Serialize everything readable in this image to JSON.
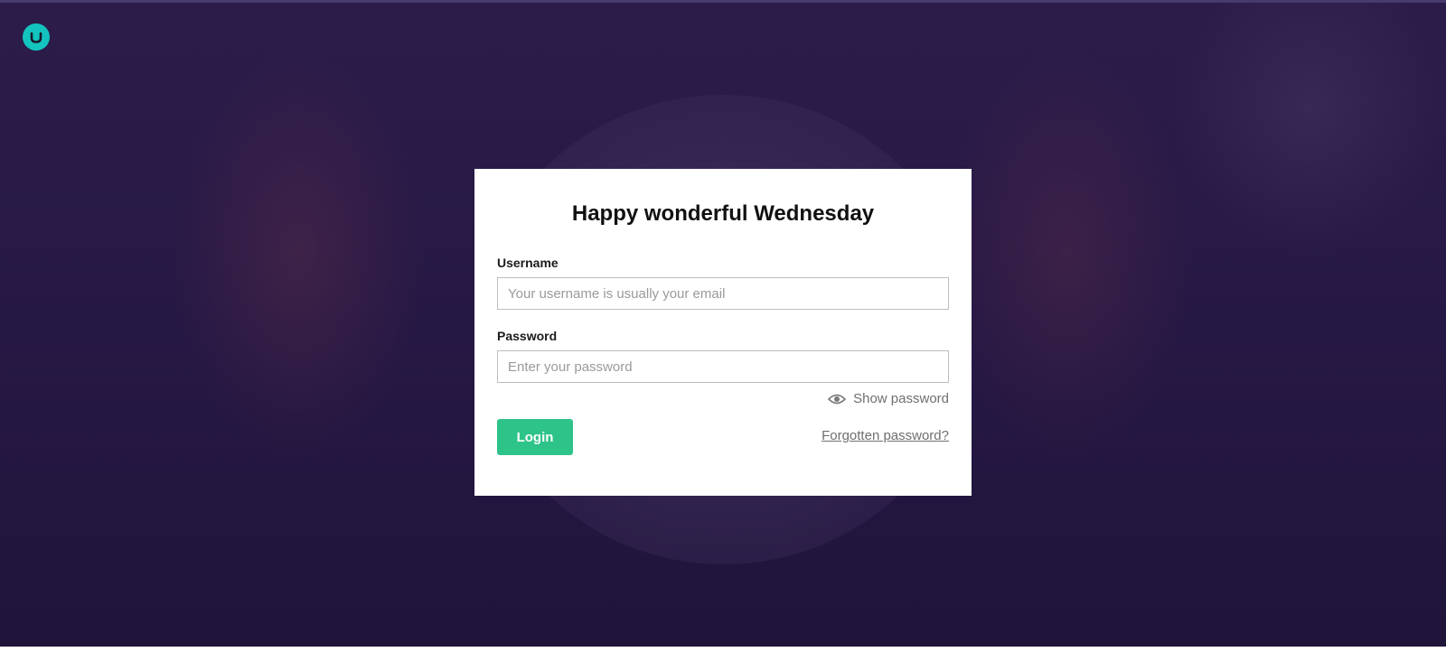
{
  "app": {
    "logo_icon": "umbraco-logo-icon",
    "brand_color": "#13c4be"
  },
  "login": {
    "greeting": "Happy wonderful Wednesday",
    "username": {
      "label": "Username",
      "placeholder": "Your username is usually your email",
      "value": ""
    },
    "password": {
      "label": "Password",
      "placeholder": "Enter your password",
      "value": ""
    },
    "show_password": {
      "label": "Show password",
      "icon": "eye-icon"
    },
    "login_button": "Login",
    "forgot_password": "Forgotten password?",
    "button_color": "#2ec389"
  }
}
